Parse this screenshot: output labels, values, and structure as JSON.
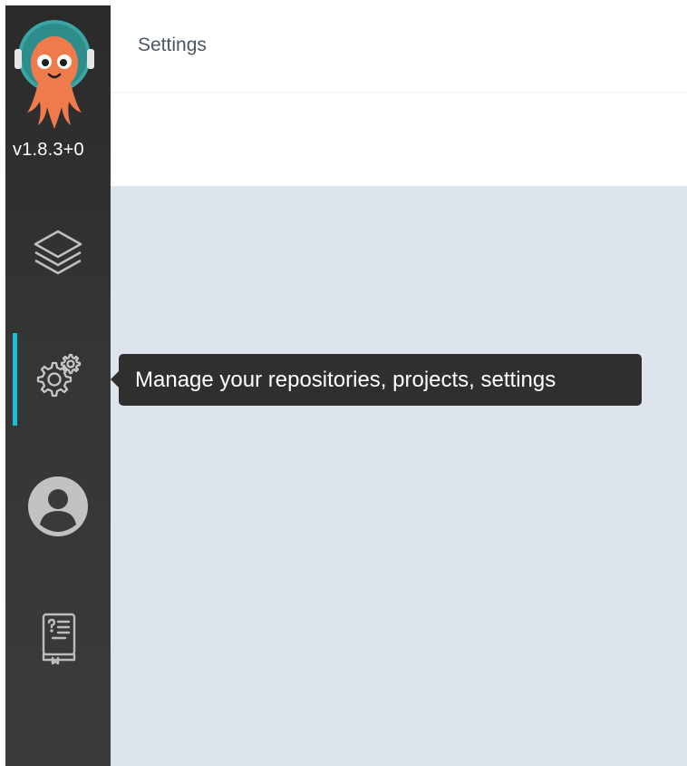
{
  "app": {
    "version": "v1.8.3+0",
    "logo_icon": "argo-octopus-logo"
  },
  "header": {
    "title": "Settings"
  },
  "sidebar": {
    "items": [
      {
        "icon": "layers-icon",
        "name": "applications",
        "active": false
      },
      {
        "icon": "gear-icon",
        "name": "settings",
        "active": true
      },
      {
        "icon": "user-icon",
        "name": "user-info",
        "active": false
      },
      {
        "icon": "docs-icon",
        "name": "documentation",
        "active": false
      }
    ],
    "accent_color": "#18bed4"
  },
  "tooltip": {
    "text": "Manage your repositories, projects, settings"
  },
  "colors": {
    "sidebar_bg": "#2e2e2e",
    "content_bg": "#dee4ec",
    "tooltip_bg": "#2f2f2f"
  }
}
